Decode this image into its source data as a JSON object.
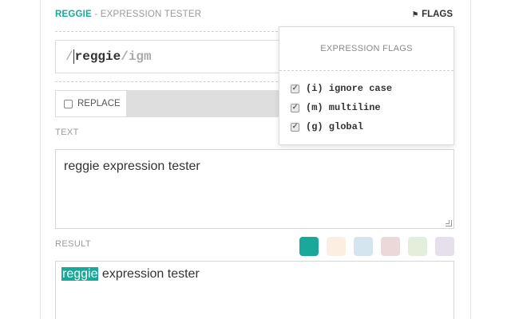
{
  "header": {
    "brand": "REGGIE",
    "subtitle": " - EXPRESSION TESTER",
    "flags_label": "FLAGS",
    "flags_icon": "flag-icon"
  },
  "expression": {
    "open_slash": "/",
    "pattern": "reggie",
    "close_slash": "/",
    "flags": "igm"
  },
  "replace": {
    "label": "REPLACE",
    "checked": false
  },
  "text_section": {
    "label": "TEXT",
    "value": "reggie expression tester"
  },
  "result_section": {
    "label": "RESULT",
    "match": "reggie",
    "rest": " expression tester",
    "swatches": [
      "#1aa89a",
      "#fcefe1",
      "#d5e5ef",
      "#ecd8d8",
      "#e4efdb",
      "#e6e0ed"
    ]
  },
  "flags_dropdown": {
    "title": "EXPRESSION FLAGS",
    "items": [
      {
        "label": "(i) ignore case",
        "checked": true
      },
      {
        "label": "(m) multiline",
        "checked": true
      },
      {
        "label": "(g) global",
        "checked": true
      }
    ]
  }
}
